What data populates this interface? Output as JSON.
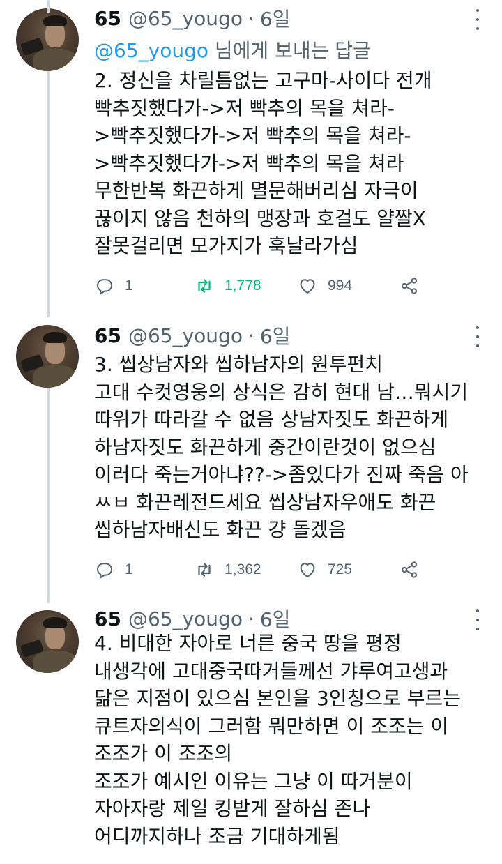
{
  "tweets": [
    {
      "name": "65",
      "handle": "@65_yougo",
      "separator": "·",
      "time": "6일",
      "reply_mention": "@65_yougo",
      "reply_text": " 님에게 보내는 답글",
      "lines": [
        "2. 정신을 차릴틈없는 고구마-사이다 전개",
        "빡추짓했다가->저 빡추의 목을 쳐라-",
        ">빡추짓했다가->저 빡추의 목을 쳐라-",
        ">빡추짓했다가->저 빡추의 목을 쳐라",
        "무한반복 화끈하게 멸문해버리심 자극이",
        "끊이지 않음 천하의 맹장과 호걸도 얄짤X",
        "잘못걸리면 모가지가 훅날라가심"
      ],
      "replies": "1",
      "retweets": "1,778",
      "likes": "994",
      "retweeted": true
    },
    {
      "name": "65",
      "handle": "@65_yougo",
      "separator": "·",
      "time": "6일",
      "lines": [
        "3. 씹상남자와 씹하남자의 원투펀치",
        "고대 수컷영웅의 상식은 감히 현대 남…뭐시기",
        "따위가 따라갈 수 없음 상남자짓도 화끈하게",
        "하남자짓도 화끈하게 중간이란것이 없으심",
        "이러다 죽는거아냐??->좀있다가 진짜 죽음 아",
        "ㅆㅂ 화끈레전드세요 씹상남자우애도 화끈",
        "씹하남자배신도 화끈 걍 돌겠음"
      ],
      "replies": "1",
      "retweets": "1,362",
      "likes": "725",
      "retweeted": false
    },
    {
      "name": "65",
      "handle": "@65_yougo",
      "separator": "·",
      "time": "6일",
      "lines": [
        "4. 비대한 자아로 너른 중국 땅을 평정",
        "내생각에 고대중국따거들께선 갸루여고생과",
        "닮은 지점이 있으심 본인을 3인칭으로 부르는",
        "큐트자의식이 그러함 뭐만하면 이 조조는 이",
        "조조가 이 조조의",
        "조조가 예시인 이유는 그냥 이 따거분이",
        "자아자랑 제일 킹받게 잘하심 존나",
        "어디까지하나 조금 기대하게됨"
      ]
    }
  ],
  "colors": {
    "text": "#0f1419",
    "secondary": "#536471",
    "link": "#1d9bf0",
    "retweet_active": "#00ba7c",
    "thread_line": "#cfd9de"
  },
  "icons": [
    "reply-icon",
    "retweet-icon",
    "like-icon",
    "share-icon",
    "more-icon"
  ]
}
